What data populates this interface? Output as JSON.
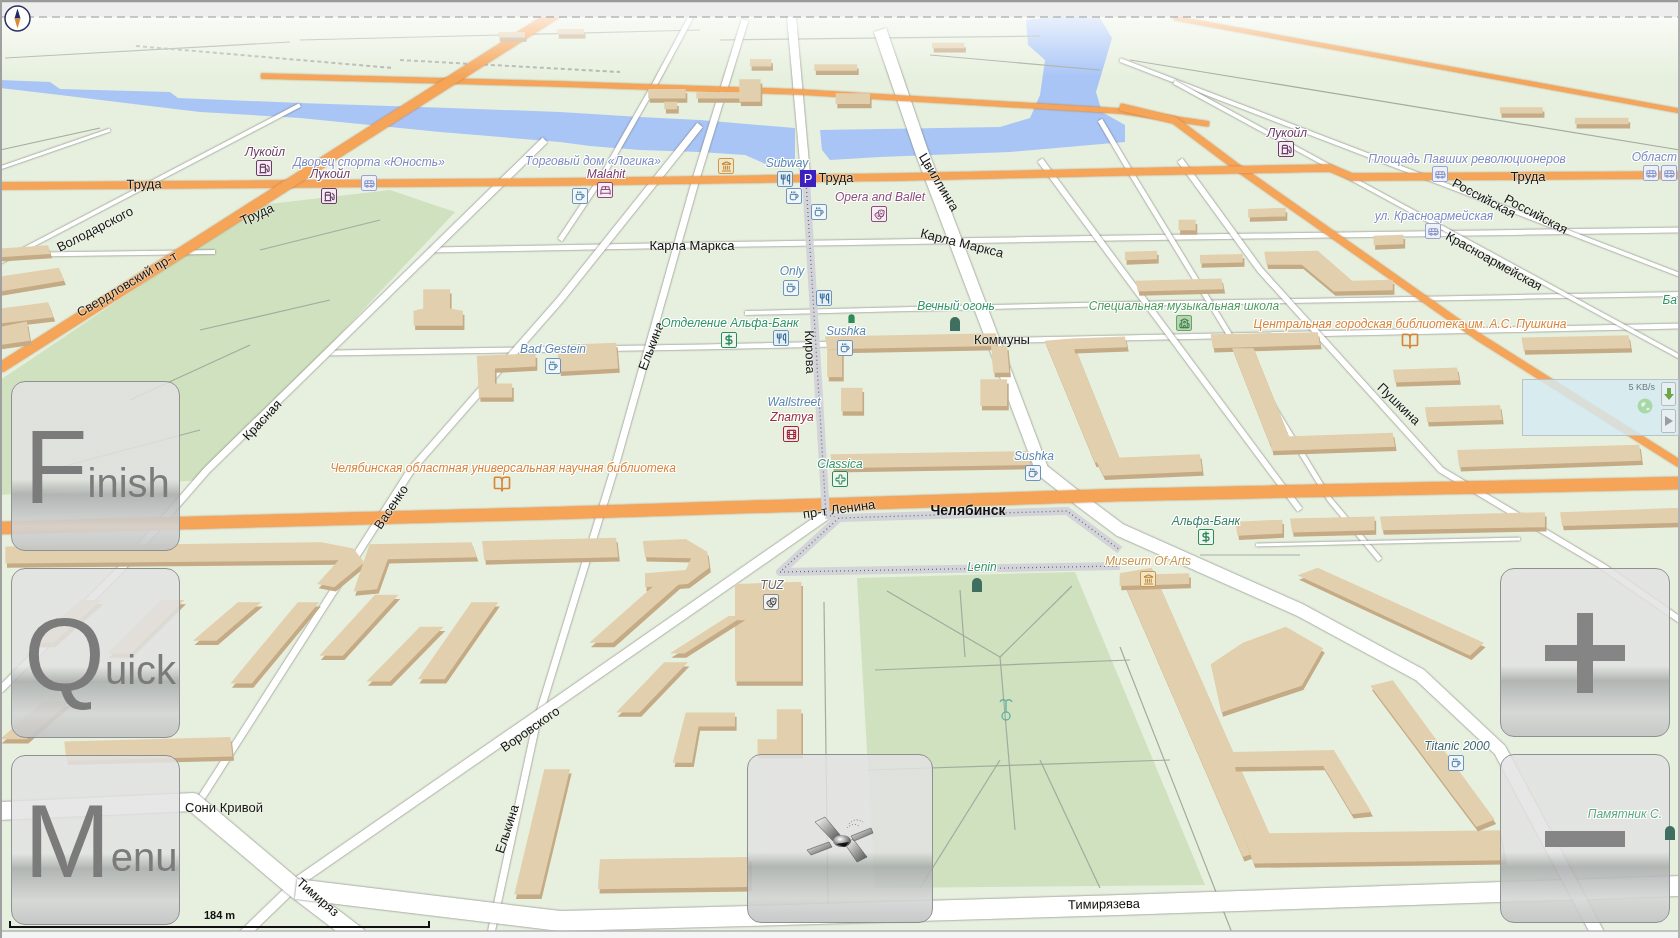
{
  "map": {
    "streets": [
      "Труда",
      "Труда",
      "Володарского",
      "Свердловский пр-т",
      "Красная",
      "Труда",
      "Цвиллинга",
      "Карла Маркса",
      "Карла Маркса",
      "Коммуны",
      "Кирова",
      "Елькина",
      "Российская",
      "Российская",
      "Труда",
      "Красноармейская",
      "Пушкина",
      "Васенко",
      "пр-т Ленина",
      "Воровского",
      "Елькина",
      "Сони Кривой",
      "Тимиряз",
      "Тимирязева"
    ],
    "places": [
      {
        "name": "Лукойл",
        "color": "#6b3a66"
      },
      {
        "name": "Дворец спорта «Юность»",
        "color": "#7e8cc2"
      },
      {
        "name": "Лукойл",
        "color": "#6b3a66"
      },
      {
        "name": "Торговый дом «Логика»",
        "color": "#7e8cc2"
      },
      {
        "name": "Malahit",
        "color": "#7a3a6e"
      },
      {
        "name": "Subway",
        "color": "#5a87b2"
      },
      {
        "name": "Opera and Ballet",
        "color": "#8c4d7c"
      },
      {
        "name": "Лукойл",
        "color": "#6b3a66"
      },
      {
        "name": "Площадь Павших революционеров",
        "color": "#7e8cc2"
      },
      {
        "name": "Област",
        "color": "#7e8cc2"
      },
      {
        "name": "ул. Красноармейская",
        "color": "#7e8cc2"
      },
      {
        "name": "Only",
        "color": "#5a87b2"
      },
      {
        "name": "Вечный огонь",
        "color": "#2f9466"
      },
      {
        "name": "Специальная музыкальная школа",
        "color": "#4c9c5e"
      },
      {
        "name": "Ба",
        "color": "#2f9466"
      },
      {
        "name": "Отделение Альфа-Банк",
        "color": "#2f9466"
      },
      {
        "name": "Центральная городская библиотека им. А.С. Пушкина",
        "color": "#d8843a"
      },
      {
        "name": "Sushka",
        "color": "#5a87b2"
      },
      {
        "name": "Bad Gestein",
        "color": "#5a87b2"
      },
      {
        "name": "Wallstreet",
        "color": "#5a87b2"
      },
      {
        "name": "Znamya",
        "color": "#962b3c"
      },
      {
        "name": "Sushka",
        "color": "#5a87b2"
      },
      {
        "name": "Classica",
        "color": "#2f9466"
      },
      {
        "name": "Челябинская областная универсальная научная библиотека",
        "color": "#d8843a"
      },
      {
        "name": "Альфа-Банк",
        "color": "#3a806a"
      },
      {
        "name": "Museum Of Arts",
        "color": "#c8944a"
      },
      {
        "name": "Lenin",
        "color": "#2f9466"
      },
      {
        "name": "TUZ",
        "color": "#666666"
      },
      {
        "name": "Titanic 2000",
        "color": "#3e6470"
      },
      {
        "name": "Памятник С.",
        "color": "#5aaa80"
      }
    ],
    "city": "Челябинск",
    "parking_sign": "P"
  },
  "side_buttons": [
    {
      "label": "Finish"
    },
    {
      "label": "Quick"
    },
    {
      "label": "Menu"
    }
  ],
  "scale_bar": {
    "label": "184 m"
  },
  "network": {
    "speed": "5 KB/s"
  }
}
